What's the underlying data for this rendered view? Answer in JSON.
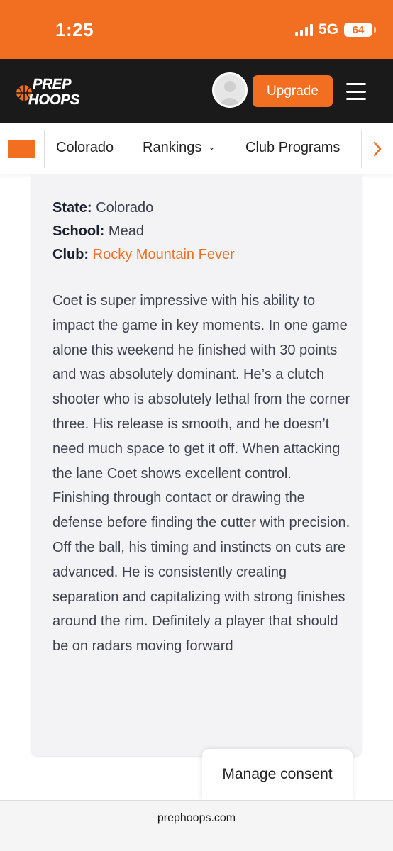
{
  "status_bar": {
    "time": "1:25",
    "network": "5G",
    "battery": "64"
  },
  "header": {
    "logo_line1": "PREP",
    "logo_line2": "HOOPS",
    "upgrade_label": "Upgrade"
  },
  "nav": {
    "items": [
      "Colorado",
      "Rankings",
      "Club Programs"
    ]
  },
  "player": {
    "state_label": "State:",
    "state": "Colorado",
    "school_label": "School:",
    "school": "Mead",
    "club_label": "Club:",
    "club": "Rocky Mountain Fever",
    "bio": "Coet is super impressive with his ability to impact the game in key moments. In one game alone this weekend he finished with 30 points and was absolutely dominant. He’s a clutch shooter who is absolutely lethal from the corner three. His release is smooth, and he doesn’t need much space to get it off. When attacking the lane Coet shows excellent control. Finishing through contact or drawing the defense before finding the cutter with precision. Off the ball, his timing and instincts on cuts are advanced. He is consistently creating separation and capitalizing with strong finishes around the rim. Definitely a player that should be on radars moving forward"
  },
  "consent": {
    "label": "Manage consent"
  },
  "browser": {
    "url": "prephoops.com"
  },
  "colors": {
    "brand": "#f26f21",
    "header_bg": "#1a1a1a",
    "card_bg": "#f3f3f5"
  }
}
